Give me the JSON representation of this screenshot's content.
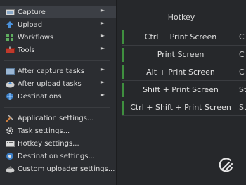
{
  "menu": {
    "items": [
      {
        "label": "Capture",
        "icon": "capture-icon",
        "submenu": true,
        "active": true
      },
      {
        "label": "Upload",
        "icon": "upload-icon",
        "submenu": true
      },
      {
        "label": "Workflows",
        "icon": "workflows-icon",
        "submenu": true
      },
      {
        "label": "Tools",
        "icon": "tools-icon",
        "submenu": true
      },
      {
        "label": "After capture tasks",
        "icon": "after-capture-icon",
        "submenu": true
      },
      {
        "label": "After upload tasks",
        "icon": "after-upload-icon",
        "submenu": true
      },
      {
        "label": "Destinations",
        "icon": "destinations-icon",
        "submenu": true
      },
      {
        "label": "Application settings...",
        "icon": "application-settings-icon",
        "submenu": false
      },
      {
        "label": "Task settings...",
        "icon": "task-settings-icon",
        "submenu": false
      },
      {
        "label": "Hotkey settings...",
        "icon": "hotkey-settings-icon",
        "submenu": false
      },
      {
        "label": "Destination settings...",
        "icon": "destination-settings-icon",
        "submenu": false
      },
      {
        "label": "Custom uploader settings...",
        "icon": "custom-uploader-icon",
        "submenu": false
      }
    ],
    "submenu_arrow": "►"
  },
  "hotkeys": {
    "header": "Hotkey",
    "rows": [
      {
        "key": "Ctrl + Print Screen",
        "extra": "C"
      },
      {
        "key": "Print Screen",
        "extra": "C"
      },
      {
        "key": "Alt + Print Screen",
        "extra": "C"
      },
      {
        "key": "Shift + Print Screen",
        "extra": "St"
      },
      {
        "key": "Ctrl + Shift + Print Screen",
        "extra": "St"
      }
    ]
  },
  "colors": {
    "accent_green": "#3f8f3f",
    "background": "#26282b",
    "menu_background": "#2b2d31"
  },
  "logo": {
    "icon": "sharex-logo-icon"
  }
}
